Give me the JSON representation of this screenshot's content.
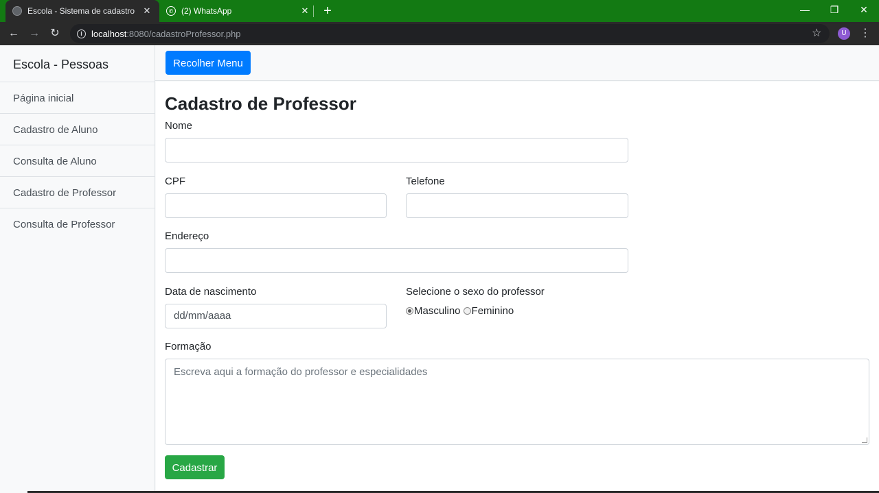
{
  "browser": {
    "tabs": [
      {
        "title": "Escola - Sistema de cadastro",
        "close": "✕"
      },
      {
        "title": "(2) WhatsApp",
        "close": "✕"
      }
    ],
    "new_tab": "+",
    "window_controls": {
      "minimize": "—",
      "restore": "❐",
      "close": "✕"
    },
    "url_host": "localhost",
    "url_rest": ":8080/cadastroProfessor.php",
    "profile_initial": "U",
    "accent_color": "#137a13",
    "icons": [
      "back-arrow-icon",
      "forward-arrow-icon",
      "reload-icon",
      "info-icon",
      "star-icon",
      "menu-dots-icon"
    ]
  },
  "sidebar": {
    "heading": "Escola - Pessoas",
    "items": [
      {
        "label": "Página inicial"
      },
      {
        "label": "Cadastro de Aluno"
      },
      {
        "label": "Consulta de Aluno"
      },
      {
        "label": "Cadastro de Professor"
      },
      {
        "label": "Consulta de Professor"
      }
    ]
  },
  "navbar": {
    "toggle_button": "Recolher Menu",
    "button_color": "#007bff"
  },
  "form": {
    "title": "Cadastro de Professor",
    "nome_label": "Nome",
    "nome_value": "",
    "cpf_label": "CPF",
    "cpf_value": "",
    "telefone_label": "Telefone",
    "telefone_value": "",
    "endereco_label": "Endereço",
    "endereco_value": "",
    "nascimento_label": "Data de nascimento",
    "nascimento_placeholder": "dd/mm/aaaa",
    "sexo_label": "Selecione o sexo do professor",
    "sexo_options": [
      {
        "label": "Masculino",
        "checked": true
      },
      {
        "label": "Feminino",
        "checked": false
      }
    ],
    "formacao_label": "Formação",
    "formacao_placeholder": "Escreva aqui a formação do professor e especialidades",
    "submit_button": "Cadastrar",
    "submit_color": "#28a745"
  }
}
